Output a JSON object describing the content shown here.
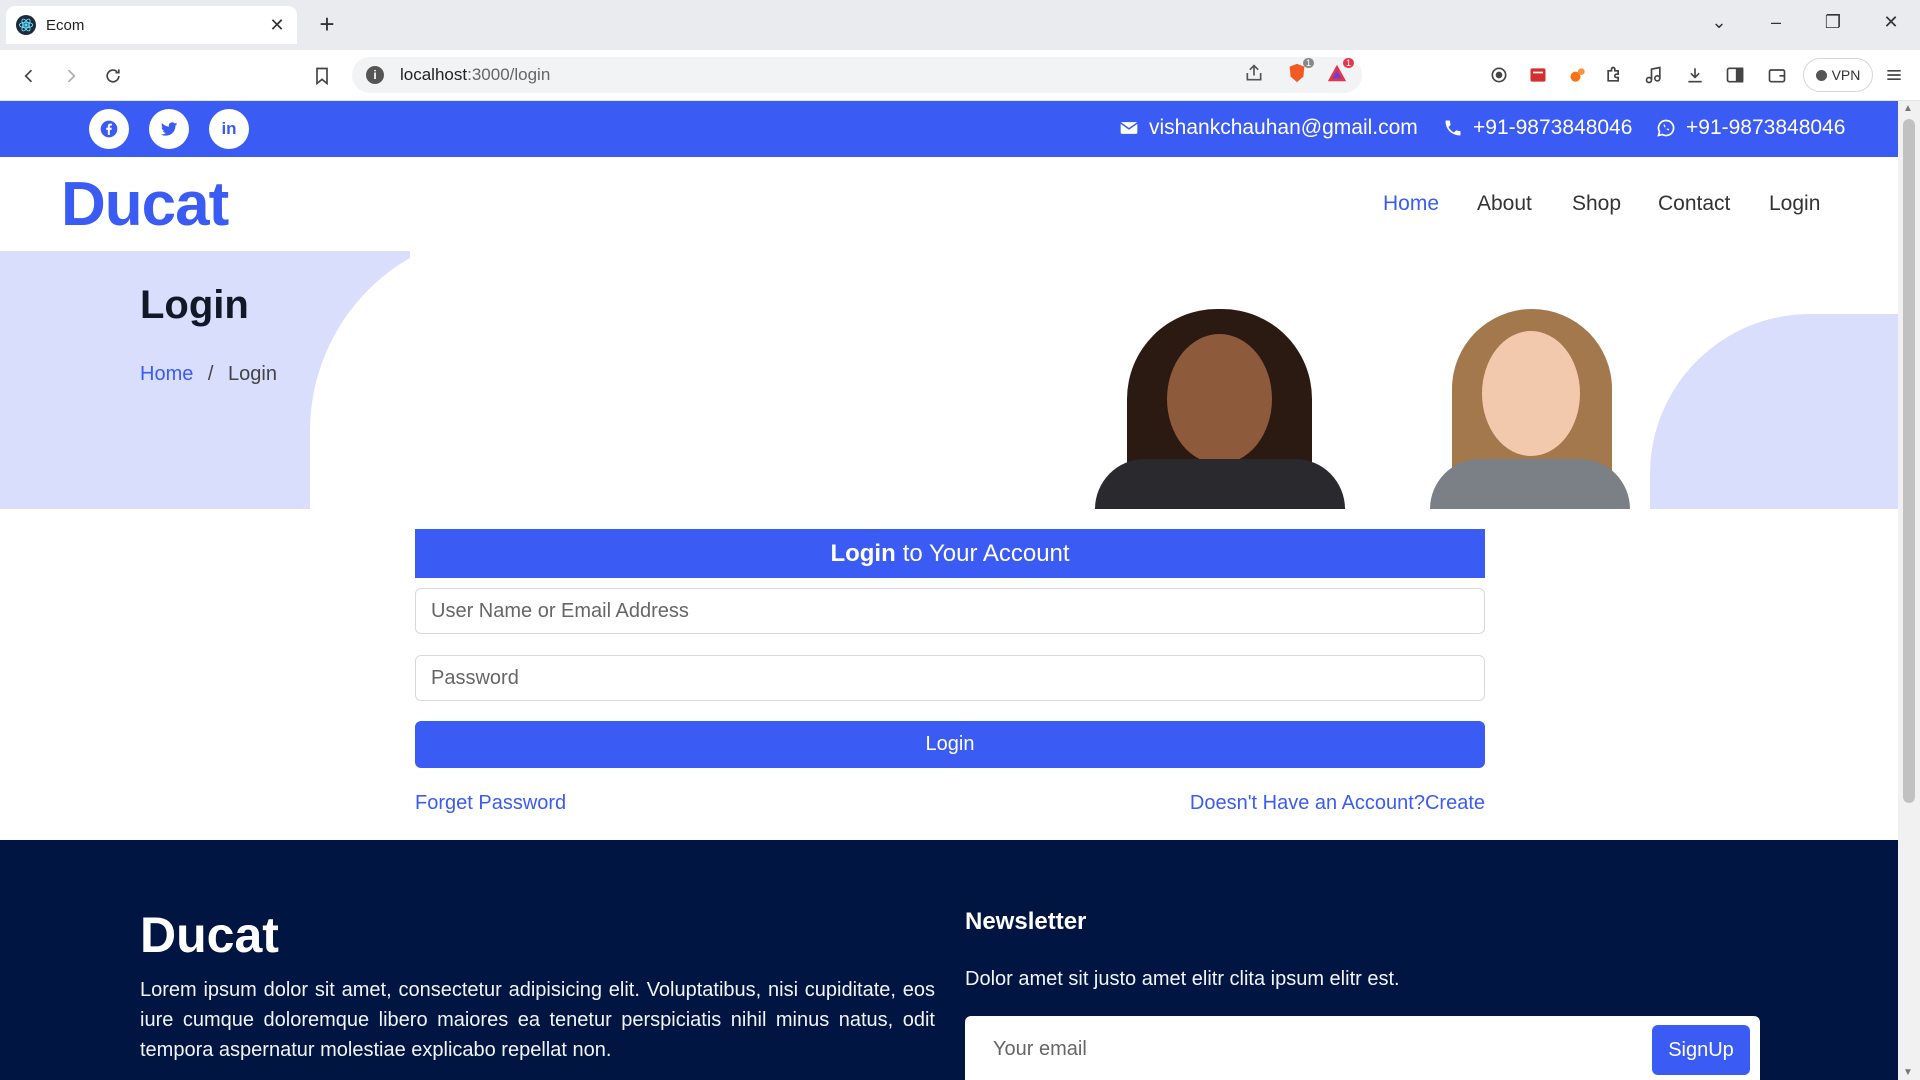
{
  "browser": {
    "tab_title": "Ecom",
    "url_host": "localhost",
    "url_path": ":3000/login",
    "vpn_label": "VPN",
    "shield_badge": "1",
    "rewards_badge": "1"
  },
  "topbar": {
    "email": "vishankchauhan@gmail.com",
    "phone": "+91-9873848046",
    "whatsapp": "+91-9873848046",
    "social": [
      "facebook-icon",
      "twitter-icon",
      "linkedin-icon"
    ],
    "linkedin_text": "in"
  },
  "header": {
    "brand": "Ducat",
    "nav": {
      "home": "Home",
      "about": "About",
      "shop": "Shop",
      "contact": "Contact",
      "login": "Login"
    }
  },
  "hero": {
    "title": "Login",
    "breadcrumb_home": "Home",
    "breadcrumb_sep": "/",
    "breadcrumb_current": "Login"
  },
  "login": {
    "heading_bold": "Login",
    "heading_rest": "to Your Account",
    "username_placeholder": "User Name or Email Address",
    "password_placeholder": "Password",
    "button": "Login",
    "forget": "Forget Password",
    "create": "Doesn't Have an Account?Create"
  },
  "footer": {
    "brand": "Ducat",
    "about": "Lorem ipsum dolor sit amet, consectetur adipisicing elit. Voluptatibus, nisi cupiditate, eos iure cumque doloremque libero maiores ea tenetur perspiciatis nihil minus natus, odit tempora aspernatur molestiae explicabo repellat non.",
    "newsletter_title": "Newsletter",
    "newsletter_text": "Dolor amet sit justo amet elitr clita ipsum elitr est.",
    "email_placeholder": "Your email",
    "signup": "SignUp"
  },
  "colors": {
    "accent": "#3b5bf5",
    "footer_bg": "#011542",
    "hero_blob": "#d9defc"
  }
}
